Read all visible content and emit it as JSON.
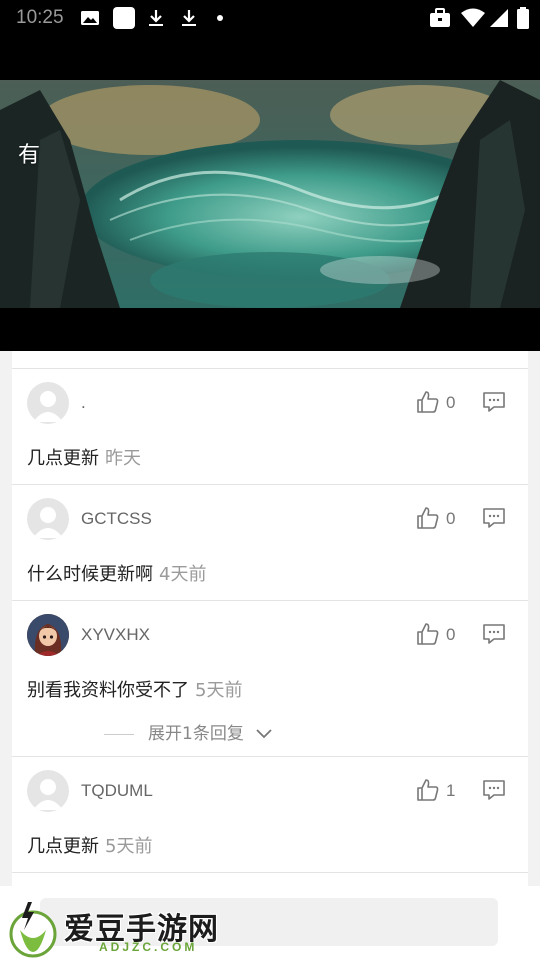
{
  "status_bar": {
    "time": "10:25",
    "left_icons": [
      "image-icon",
      "app-square-icon",
      "download-icon",
      "download-icon",
      "dot-icon"
    ],
    "right_icons": [
      "briefcase-icon",
      "wifi-icon",
      "signal-icon",
      "battery-icon"
    ]
  },
  "banner": {
    "title": "有"
  },
  "comments": [
    {
      "username": ".",
      "avatar": "default-avatar",
      "likes": "0",
      "text": "几点更新",
      "time": "昨天"
    },
    {
      "username": "GCTCSS",
      "avatar": "default-avatar",
      "likes": "0",
      "text": "什么时候更新啊",
      "time": "4天前"
    },
    {
      "username": "XYVXHX",
      "avatar": "anime-girl-avatar",
      "likes": "0",
      "text": "别看我资料你受不了",
      "time": "5天前",
      "expand": "展开1条回复"
    },
    {
      "username": "TQDUML",
      "avatar": "default-avatar",
      "likes": "1",
      "text": "几点更新",
      "time": "5天前"
    }
  ],
  "watermark": {
    "brand": "爱豆手游网",
    "domain": "ADJZC.COM"
  },
  "colors": {
    "status_bar": "#000000",
    "list_bg": "#ffffff",
    "meta_text": "#9a9a9a",
    "brand_green": "#6ba53a"
  }
}
